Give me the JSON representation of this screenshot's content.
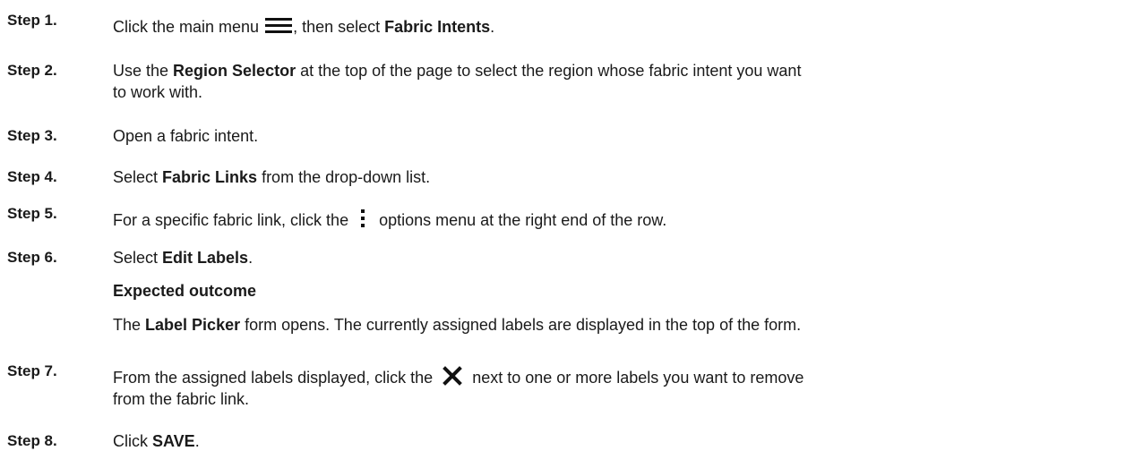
{
  "steps": [
    {
      "label": "Step 1.",
      "parts": {
        "a": "Click the main menu ",
        "icon": "hamburger-menu-icon",
        "b": ", then select ",
        "bold": "Fabric Intents",
        "c": "."
      }
    },
    {
      "label": "Step 2.",
      "parts": {
        "a": "Use the ",
        "bold": "Region Selector",
        "b": " at the top of the page to select the region whose fabric intent you want",
        "c": "to work with."
      }
    },
    {
      "label": "Step 3.",
      "parts": {
        "a": "Open a fabric intent."
      }
    },
    {
      "label": "Step 4.",
      "parts": {
        "a": "Select ",
        "bold": "Fabric Links",
        "b": " from the drop-down list."
      }
    },
    {
      "label": "Step 5.",
      "parts": {
        "a": "For a specific fabric link, click the ",
        "icon": "vertical-ellipsis-icon",
        "b": " options menu at the right end of the row."
      }
    },
    {
      "label": "Step 6.",
      "parts": {
        "a": "Select ",
        "bold": "Edit Labels",
        "b": ".",
        "outcome_title": "Expected outcome",
        "outcome_a": "The ",
        "outcome_bold": "Label Picker",
        "outcome_b": " form opens. The currently assigned labels are displayed in the top of the form."
      }
    },
    {
      "label": "Step 7.",
      "parts": {
        "a": "From the assigned labels displayed, click the ",
        "icon": "close-x-icon",
        "b": " next to one or more labels you want to remove",
        "c": "from the fabric link."
      }
    },
    {
      "label": "Step 8.",
      "parts": {
        "a": "Click ",
        "bold": "SAVE",
        "b": "."
      }
    }
  ]
}
